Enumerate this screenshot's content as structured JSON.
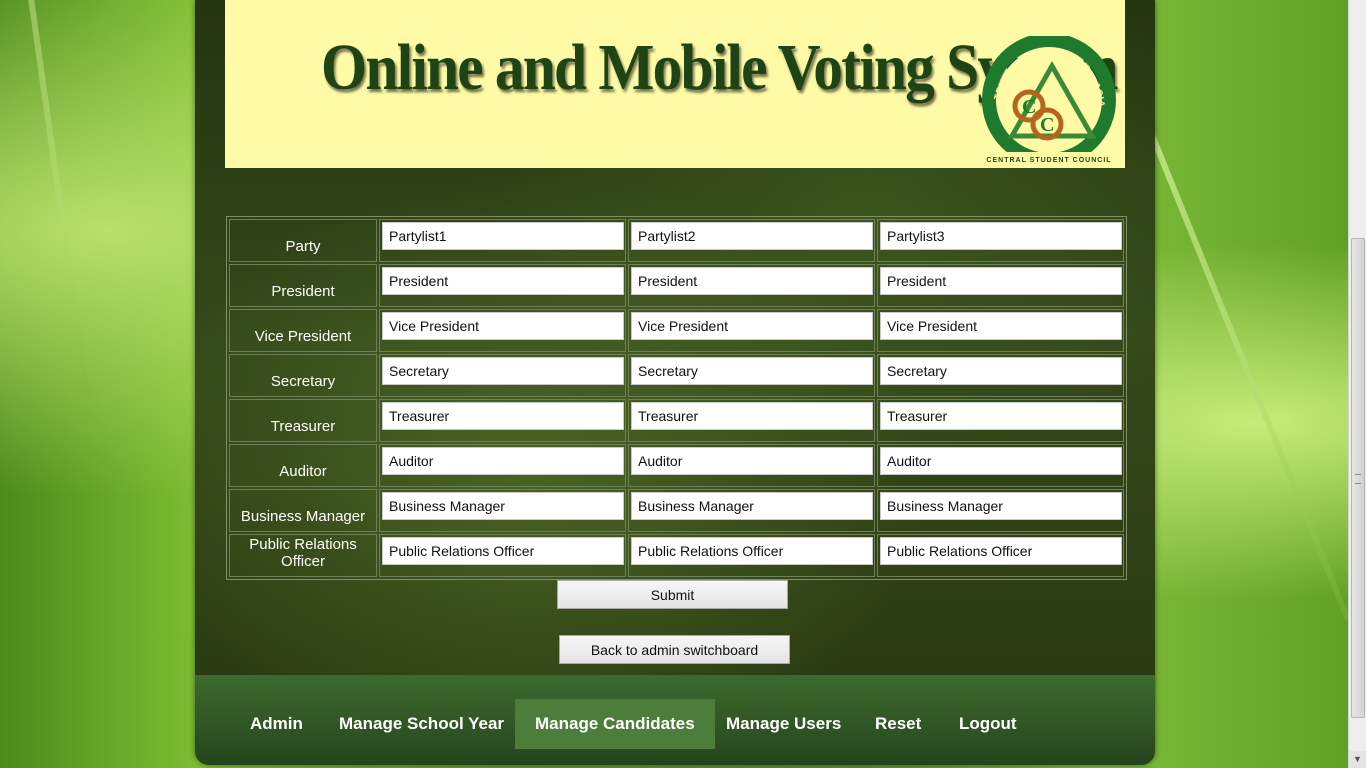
{
  "banner": {
    "title": "Online and Mobile Voting System",
    "logo_top_text": "TRINITY UNIVERSITY OF ASIA",
    "logo_bottom_text": "CENTRAL STUDENT COUNCIL"
  },
  "table": {
    "rows": [
      {
        "label": "Party",
        "values": [
          "Partylist1",
          "Partylist2",
          "Partylist3"
        ]
      },
      {
        "label": "President",
        "values": [
          "President",
          "President",
          "President"
        ]
      },
      {
        "label": "Vice President",
        "values": [
          "Vice President",
          "Vice President",
          "Vice President"
        ]
      },
      {
        "label": "Secretary",
        "values": [
          "Secretary",
          "Secretary",
          "Secretary"
        ]
      },
      {
        "label": "Treasurer",
        "values": [
          "Treasurer",
          "Treasurer",
          "Treasurer"
        ]
      },
      {
        "label": "Auditor",
        "values": [
          "Auditor",
          "Auditor",
          "Auditor"
        ]
      },
      {
        "label": "Business Manager",
        "values": [
          "Business Manager",
          "Business Manager",
          "Business Manager"
        ]
      },
      {
        "label": "Public Relations Officer",
        "values": [
          "Public Relations Officer",
          "Public Relations Officer",
          "Public Relations Officer"
        ]
      }
    ]
  },
  "buttons": {
    "submit": "Submit",
    "back": "Back to admin switchboard"
  },
  "nav": {
    "items": [
      "Admin",
      "Manage School Year",
      "Manage Candidates",
      "Manage Users",
      "Reset",
      "Logout"
    ],
    "active": "Manage Candidates"
  },
  "colors": {
    "banner_bg": "#fffaa6",
    "title_text": "#1e4416",
    "nav_bg": "#2f5424",
    "nav_active": "#4d7d3a",
    "logo_green": "#1f7a2e",
    "logo_brown": "#b5651d"
  }
}
